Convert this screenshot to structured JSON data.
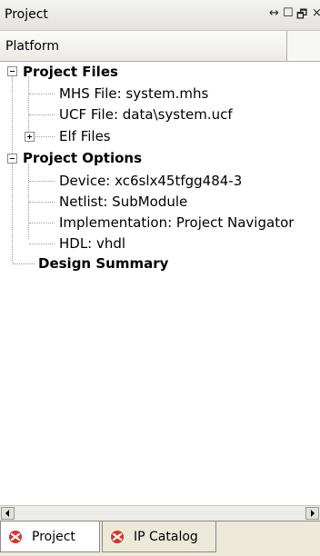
{
  "panel": {
    "title": "Project",
    "controls": {
      "resize": "↔",
      "maximize": "☐",
      "restore": "🗗",
      "close": "×"
    }
  },
  "tab_header": {
    "label": "Platform"
  },
  "tree": {
    "project_files": {
      "label": "Project Files",
      "mhs_file": "MHS File: system.mhs",
      "ucf_file": "UCF File: data\\system.ucf",
      "elf_files": "Elf Files"
    },
    "project_options": {
      "label": "Project Options",
      "device": "Device: xc6slx45tfgg484-3",
      "netlist": "Netlist: SubModule",
      "implementation": "Implementation: Project Navigator",
      "hdl": "HDL: vhdl"
    },
    "design_summary": {
      "label": "Design Summary"
    }
  },
  "bottom_tabs": [
    {
      "label": "Project",
      "icon": "xilinx-icon",
      "active": true
    },
    {
      "label": "IP Catalog",
      "icon": "xilinx-icon",
      "active": false
    }
  ],
  "colors": {
    "icon_red": "#d8342b",
    "tab_bg": "#ece9d8"
  }
}
